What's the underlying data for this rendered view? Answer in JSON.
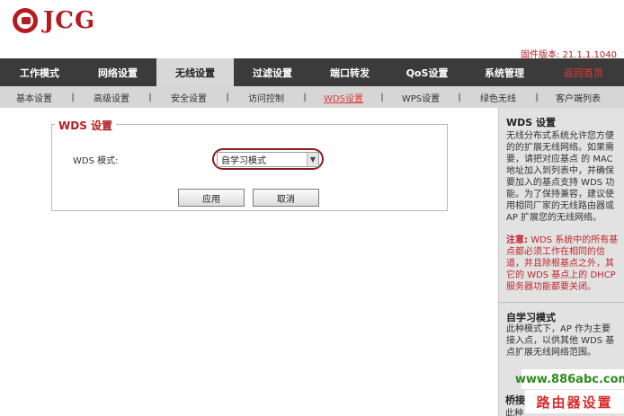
{
  "brand": {
    "logo_text": "JCG"
  },
  "firmware": "固件版本: 21.1.1.1040",
  "mainnav": {
    "items": [
      {
        "label": "工作模式"
      },
      {
        "label": "网络设置"
      },
      {
        "label": "无线设置"
      },
      {
        "label": "过滤设置"
      },
      {
        "label": "端口转发"
      },
      {
        "label": "QoS设置"
      },
      {
        "label": "系统管理"
      },
      {
        "label": "返回首页"
      }
    ],
    "active_index": 2
  },
  "subnav": {
    "items": [
      {
        "label": "基本设置"
      },
      {
        "label": "高级设置"
      },
      {
        "label": "安全设置"
      },
      {
        "label": "访问控制"
      },
      {
        "label": "WDS设置"
      },
      {
        "label": "WPS设置"
      },
      {
        "label": "绿色无线"
      },
      {
        "label": "客户端列表"
      }
    ],
    "separator": "|",
    "active_index": 4
  },
  "form": {
    "legend": "WDS 设置",
    "mode_label": "WDS 模式:",
    "mode_value": "自学习模式",
    "apply_label": "应用",
    "cancel_label": "取消"
  },
  "help": {
    "title": "WDS 设置",
    "text": "无线分布式系统允许您方便的的扩展无线网络。如果需要，请把对应基点 的 MAC 地址加入到列表中，并确保要加入的基点支持 WDS 功能。为了保持兼容，建议使用相同厂家的无线路由器或 AP 扩展您的无线网络。",
    "note_label": "注意:",
    "note_text": "WDS 系统中的所有基点都必须工作在相同的信道，并且除根基点之外，其它的 WDS 基点上的 DHCP 服务器功能都要关闭。",
    "section2_title": "自学习模式",
    "section2_text": "此种模式下，AP 作为主要接入点，以供其他 WDS 基点扩展无线网络范围。",
    "section3_title": "桥接",
    "section3_text": "此种"
  },
  "watermark": {
    "site": "www.886abc.com",
    "text": "路由器设置"
  }
}
